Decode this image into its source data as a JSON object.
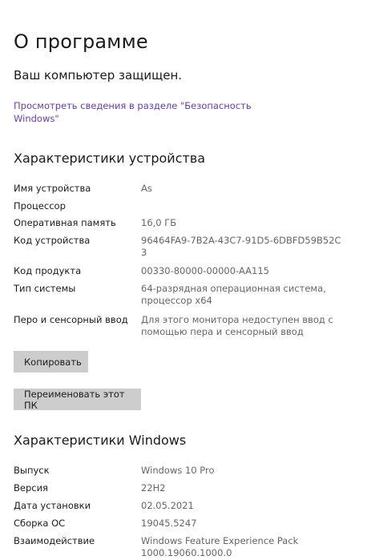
{
  "page": {
    "title": "О программе",
    "protected_text": "Ваш компьютер защищен.",
    "security_link": "Просмотреть сведения в разделе \"Безопасность Windows\""
  },
  "device": {
    "section_title": "Характеристики устройства",
    "rows": [
      {
        "label": "Имя устройства",
        "value": "As"
      },
      {
        "label": "Процессор",
        "value": ""
      },
      {
        "label": "Оперативная память",
        "value": "16,0 ГБ"
      },
      {
        "label": "Код устройства",
        "value": "96464FA9-7B2A-43C7-91D5-6DBFD59B52C3"
      },
      {
        "label": "Код продукта",
        "value": "00330-80000-00000-AA115"
      },
      {
        "label": "Тип системы",
        "value": "64-разрядная операционная система, процессор x64"
      },
      {
        "label": "Перо и сенсорный ввод",
        "value": "Для этого монитора недоступен ввод с помощью пера и сенсорный ввод"
      }
    ],
    "copy_button": "Копировать",
    "rename_button": "Переименовать этот ПК"
  },
  "windows": {
    "section_title": "Характеристики Windows",
    "rows": [
      {
        "label": "Выпуск",
        "value": "Windows 10 Pro"
      },
      {
        "label": "Версия",
        "value": "22H2"
      },
      {
        "label": "Дата установки",
        "value": "02.05.2021"
      },
      {
        "label": "Сборка ОС",
        "value": "19045.5247"
      },
      {
        "label": "Взаимодействие",
        "value": "Windows Feature Experience Pack 1000.19060.1000.0"
      }
    ]
  }
}
